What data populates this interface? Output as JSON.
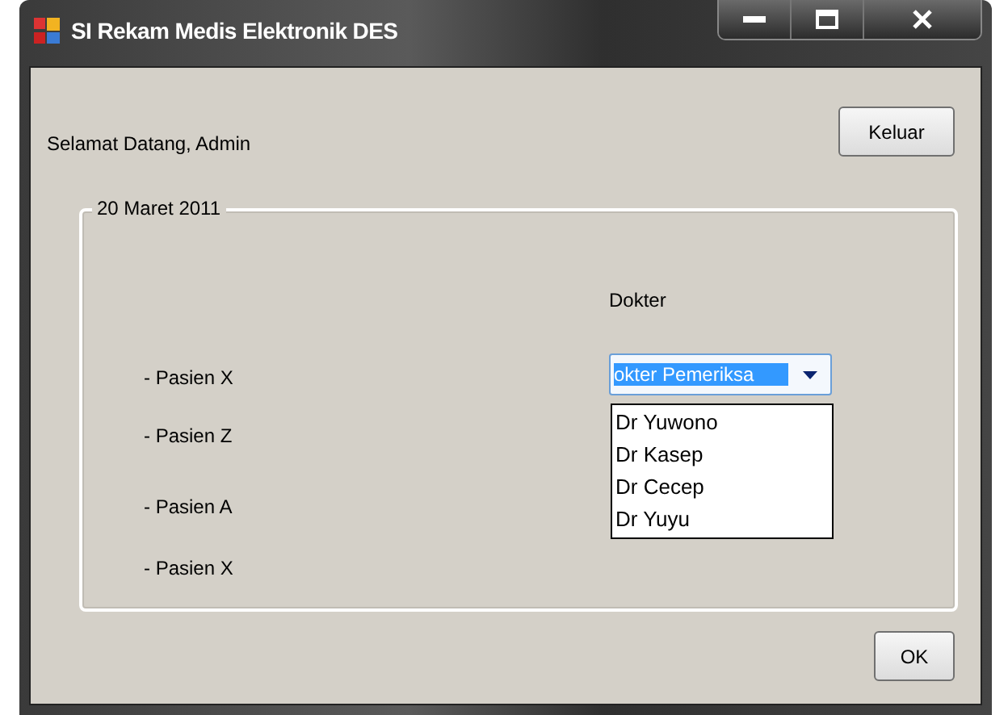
{
  "window": {
    "title": "SI Rekam Medis Elektronik DES"
  },
  "greeting": "Selamat Datang, Admin",
  "logout_button": "Keluar",
  "group": {
    "title": "20 Maret 2011",
    "patients": [
      "- Pasien X",
      "- Pasien Z",
      "- Pasien A",
      "- Pasien X"
    ],
    "doctor_label": "Dokter",
    "doctor_combo": {
      "value": "okter Pemeriksa",
      "expanded": true,
      "options": [
        "Dr Yuwono",
        "Dr Kasep",
        "Dr Cecep",
        "Dr Yuyu"
      ]
    }
  },
  "ok_button": "OK"
}
